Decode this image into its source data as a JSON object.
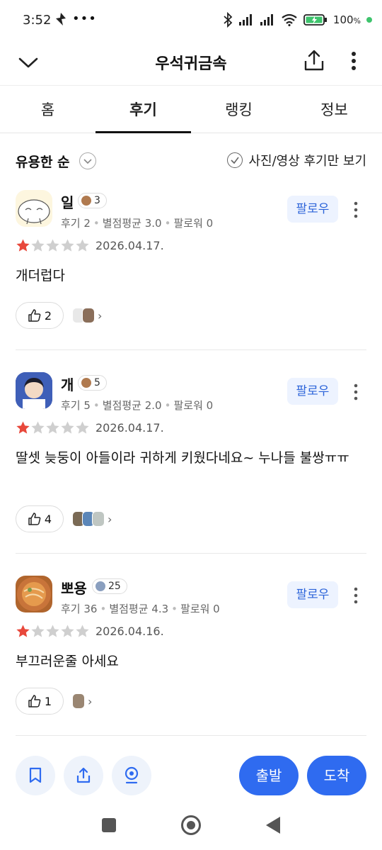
{
  "status_bar": {
    "time": "3:52",
    "battery": "100",
    "battery_unit": "%"
  },
  "app_bar": {
    "title": "우석귀금속"
  },
  "tabs": [
    {
      "label": "홈",
      "active": false
    },
    {
      "label": "후기",
      "active": true
    },
    {
      "label": "랭킹",
      "active": false
    },
    {
      "label": "정보",
      "active": false
    }
  ],
  "filter": {
    "sort_label": "유용한 순",
    "photo_only_label": "사진/영상 후기만 보기"
  },
  "reviews": [
    {
      "name": "일",
      "level": "3",
      "review_count": "후기 2",
      "avg_rating": "별점평균 3.0",
      "followers": "팔로워 0",
      "follow_label": "팔로우",
      "stars": 1,
      "date": "2026.04.17.",
      "text": "개더럽다",
      "likes": "2"
    },
    {
      "name": "개",
      "level": "5",
      "review_count": "후기 5",
      "avg_rating": "별점평균 2.0",
      "followers": "팔로워 0",
      "follow_label": "팔로우",
      "stars": 1,
      "date": "2026.04.17.",
      "text": "딸셋 늦둥이 아들이라 귀하게 키웠다네요~ 누나들 불쌍ㅠㅠ",
      "likes": "4"
    },
    {
      "name": "뽀용",
      "level": "25",
      "review_count": "후기 36",
      "avg_rating": "별점평균 4.3",
      "followers": "팔로워 0",
      "follow_label": "팔로우",
      "stars": 1,
      "date": "2026.04.16.",
      "text": "부끄러운줄 아세요",
      "likes": "1"
    }
  ],
  "bottom_actions": {
    "depart_label": "출발",
    "arrive_label": "도착"
  },
  "colors": {
    "accent": "#2f6bf0",
    "star_filled": "#e8483b",
    "star_empty": "#cfcfcf",
    "follow_bg": "#edf3ff"
  }
}
